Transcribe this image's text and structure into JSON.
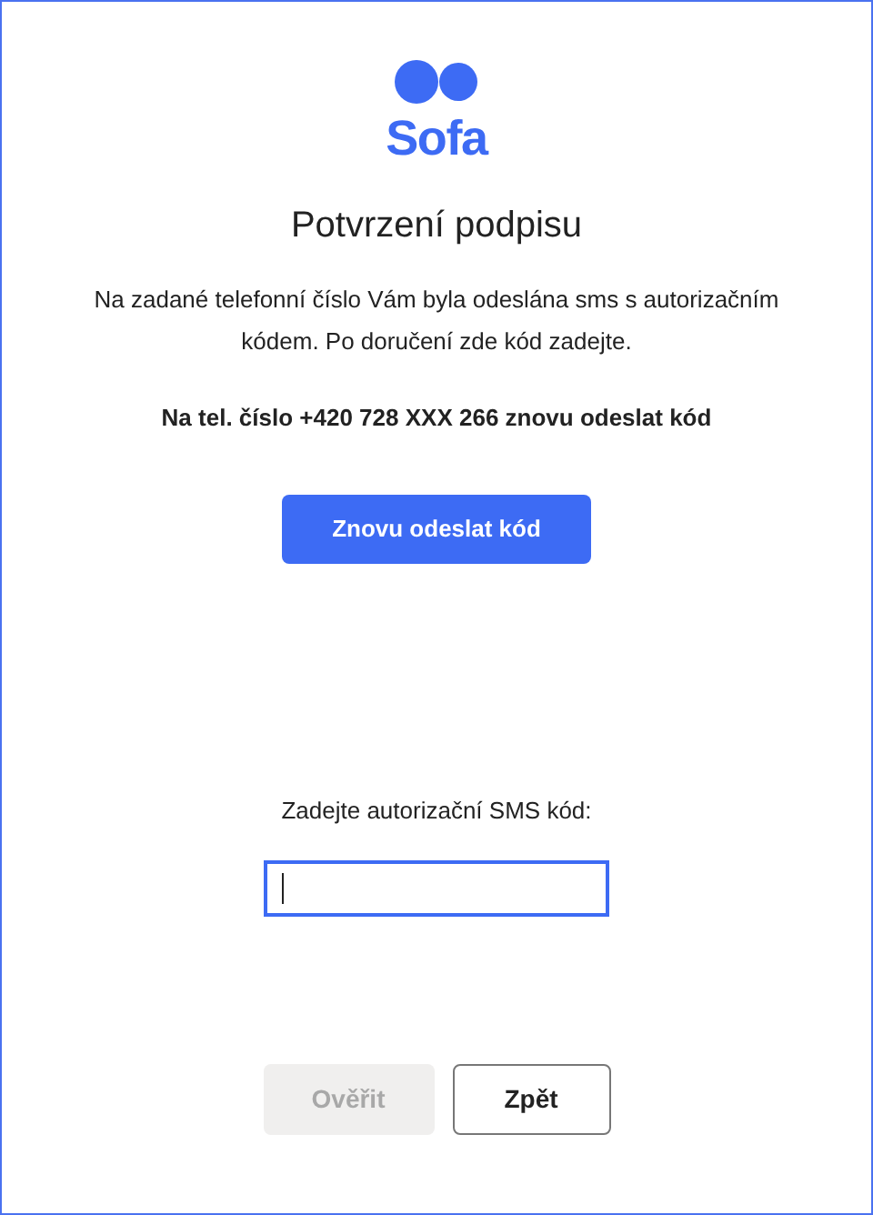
{
  "logo": {
    "text": "Sofa"
  },
  "title": "Potvrzení podpisu",
  "intro": "Na zadané telefonní číslo Vám byla odeslána sms s autorizačním kódem. Po doručení zde kód zadejte.",
  "resend_info": "Na tel. číslo +420 728 XXX 266 znovu odeslat kód",
  "resend_button": {
    "label": "Znovu odeslat kód",
    "disabled": false
  },
  "code_field": {
    "label": "Zadejte autorizační SMS kód:",
    "focused": true
  },
  "buttons": [
    {
      "label": "Ověřit",
      "kind": "primary",
      "disabled": true
    },
    {
      "label": "Zpět",
      "kind": "secondary",
      "disabled": false
    }
  ]
}
